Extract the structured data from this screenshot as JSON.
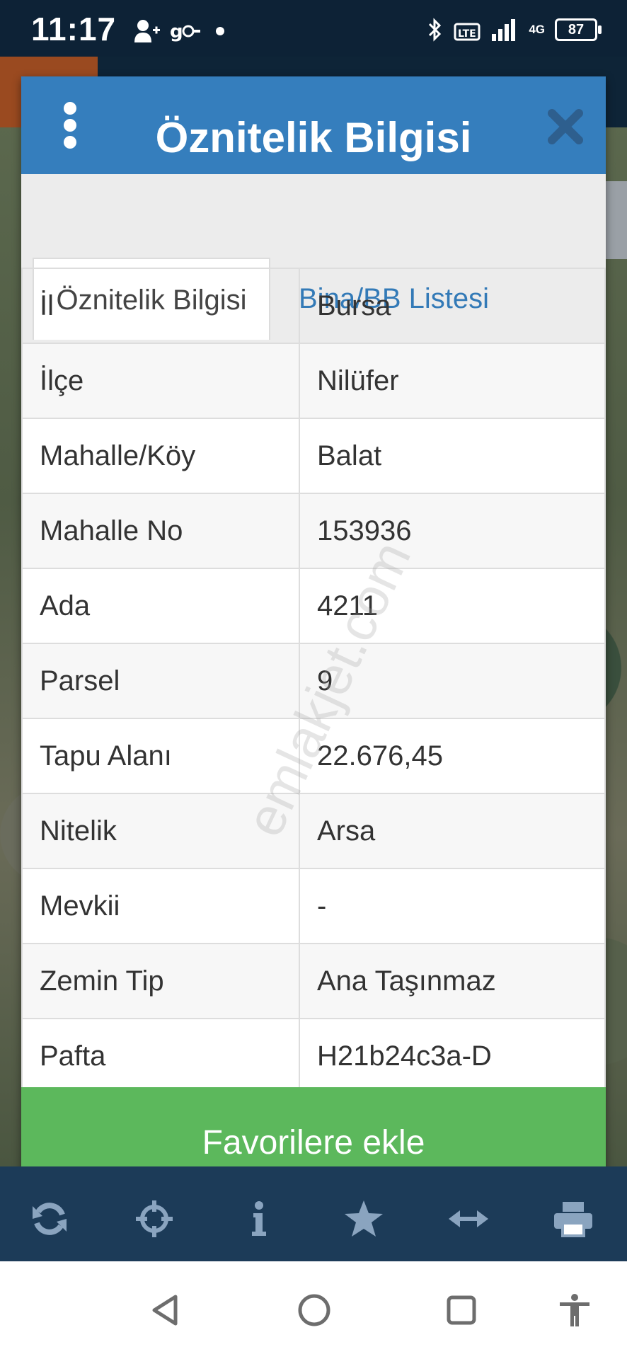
{
  "status": {
    "time": "11:17",
    "battery": "87",
    "network": "4G",
    "volte": "LTE"
  },
  "dialog": {
    "title": "Öznitelik Bilgisi",
    "tabs": [
      {
        "label": "Öznitelik Bilgisi",
        "active": true
      },
      {
        "label": "Bina/BB Listesi",
        "active": false
      }
    ],
    "rows": [
      {
        "key": "İl",
        "value": "Bursa"
      },
      {
        "key": "İlçe",
        "value": "Nilüfer"
      },
      {
        "key": "Mahalle/Köy",
        "value": "Balat"
      },
      {
        "key": "Mahalle No",
        "value": "153936"
      },
      {
        "key": "Ada",
        "value": "4211"
      },
      {
        "key": "Parsel",
        "value": "9"
      },
      {
        "key": "Tapu Alanı",
        "value": "22.676,45"
      },
      {
        "key": "Nitelik",
        "value": "Arsa"
      },
      {
        "key": "Mevkii",
        "value": "-"
      },
      {
        "key": "Zemin Tip",
        "value": "Ana Taşınmaz"
      },
      {
        "key": "Pafta",
        "value": "H21b24c3a-D"
      }
    ],
    "favorite_button": "Favorilere ekle"
  },
  "watermark": "emlakjet.com",
  "toolbar_icons": [
    "refresh-icon",
    "crosshair-icon",
    "info-icon",
    "star-icon",
    "measure-icon",
    "print-icon"
  ],
  "nav_icons": [
    "back-icon",
    "home-icon",
    "recents-icon",
    "accessibility-icon"
  ],
  "colors": {
    "header": "#357ebd",
    "tab_link": "#337ab7",
    "favorite": "#5cb85c",
    "toolbar": "#1c3b58",
    "toolbar_icon": "#8aa4bf"
  }
}
